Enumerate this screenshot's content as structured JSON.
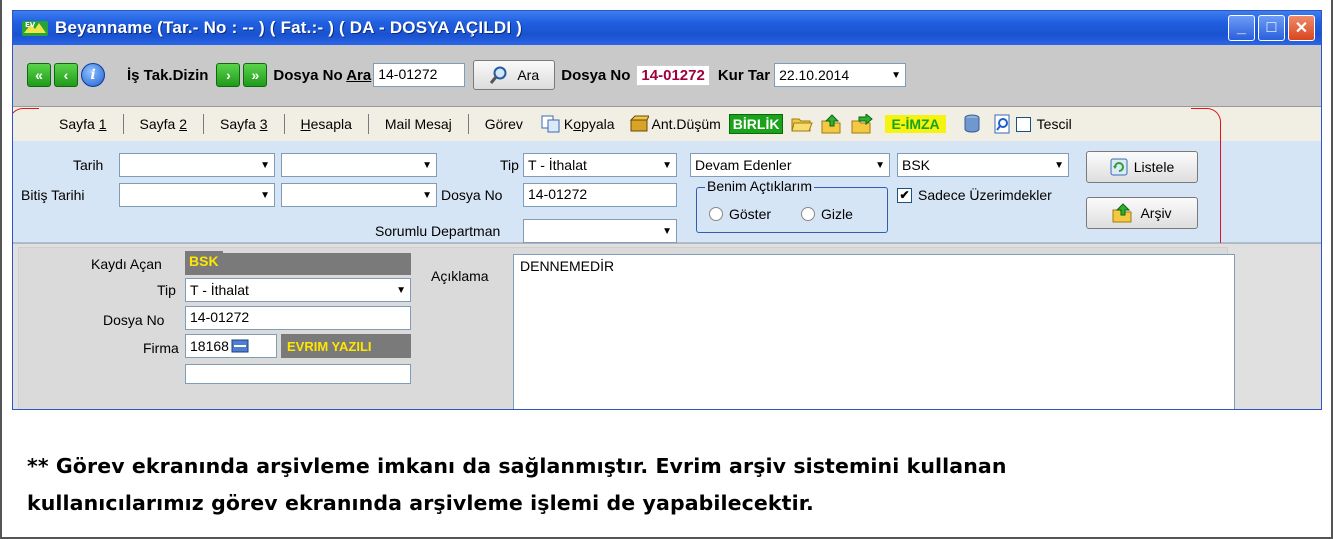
{
  "window": {
    "title": "Beyanname (Tar.- No :  --  ) ( Fat.:- ) ( DA - DOSYA AÇILDI )",
    "controls": {
      "minimize": "_",
      "maximize": "□",
      "close": "✕"
    }
  },
  "toolbar": {
    "is_tak_label": "İş Tak.Dizin",
    "dosya_no_ara_label_pre": "Dosya No ",
    "dosya_no_ara_label_u": "Ara",
    "dosya_no_ara_value": "14-01272",
    "ara_button": "Ara",
    "dosya_no_label": "Dosya No",
    "dosya_no_value": "14-01272",
    "kur_tar_label": "Kur Tar",
    "kur_tar_value": "22.10.2014"
  },
  "tabs": {
    "sayfa1_pre": "Sayfa ",
    "sayfa1_u": "1",
    "sayfa2_pre": "Sayfa ",
    "sayfa2_u": "2",
    "sayfa3_pre": "Sayfa ",
    "sayfa3_u": "3",
    "hesapla_u": "H",
    "hesapla_rest": "esapla",
    "mail": "Mail Mesaj",
    "gorev": "Görev",
    "kopyala_pre": "K",
    "kopyala_u": "o",
    "kopyala_rest": "pyala",
    "ant_dusum": "Ant.Düşüm",
    "birlik": "BİRLİK",
    "eimza": "E-İMZA",
    "tescil": "Tescil"
  },
  "filter": {
    "tarih_label": "Tarih",
    "bitis_label": "Bitiş Tarihi",
    "tip_label": "Tip",
    "tip_value": "T - İthalat",
    "dosya_no_label": "Dosya No",
    "dosya_no_value": "14-01272",
    "sorumlu_label": "Sorumlu Departman",
    "durum_value": "Devam Edenler",
    "kullanici_value": "BSK",
    "benim_title": "Benim Açtıklarım",
    "goster": "Göster",
    "gizle": "Gizle",
    "sadece": "Sadece Üzerimdekler",
    "listele": "Listele",
    "arsiv": "Arşiv"
  },
  "detail": {
    "kaydi_acan_label": "Kaydı Açan",
    "kaydi_acan_value": "BSK",
    "tip_label": "Tip",
    "tip_value": "T - İthalat",
    "dosya_no_label": "Dosya No",
    "dosya_no_value": "14-01272",
    "firma_label": "Firma",
    "firma_code": "18168",
    "firma_name": "EVRIM YAZILI",
    "aciklama_label": "Açıklama",
    "aciklama_value": "DENNEMEDİR"
  },
  "caption": {
    "line1": "** Görev ekranında arşivleme imkanı da sağlanmıştır. Evrim arşiv sistemini kullanan",
    "line2": "kullanıcılarımız görev ekranında arşivleme işlemi de yapabilecektir."
  },
  "colors": {
    "title_bar": "#1f5fe0",
    "filter_panel": "#d6e5f5",
    "highlight_frame": "#e0141e",
    "birlik_bg": "#1aa31a",
    "eimza_bg": "#f6f311",
    "dosya_no_text": "#a0003c"
  }
}
